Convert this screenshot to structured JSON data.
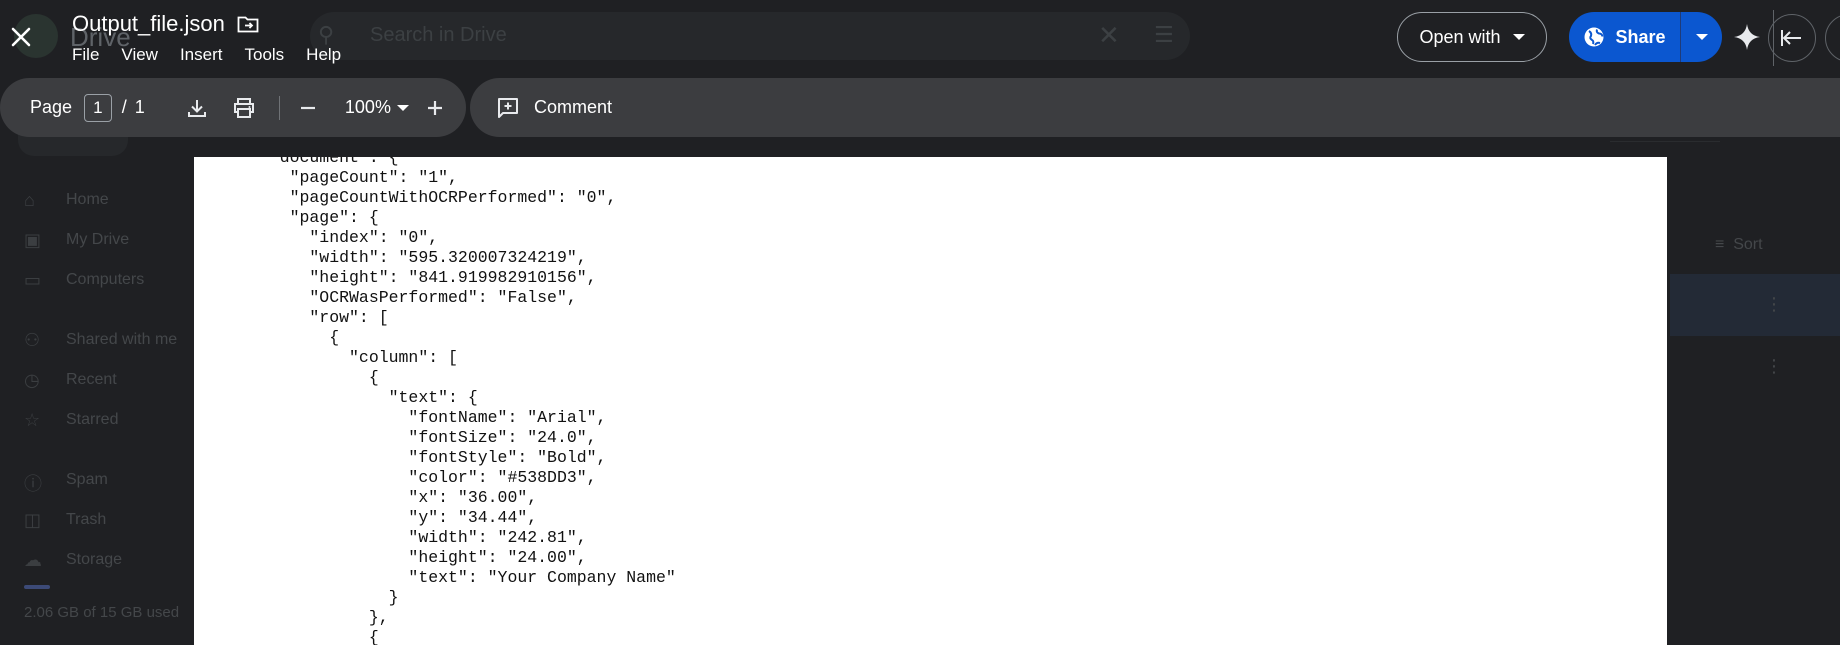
{
  "background": {
    "app_title": "Drive",
    "search_placeholder": "Search in Drive",
    "nav_items": [
      {
        "label": "Home",
        "icon": "home-icon"
      },
      {
        "label": "My Drive",
        "icon": "drive-icon"
      },
      {
        "label": "Computers",
        "icon": "computer-icon"
      },
      {
        "label": "Shared with me",
        "icon": "people-icon"
      },
      {
        "label": "Recent",
        "icon": "clock-icon"
      },
      {
        "label": "Starred",
        "icon": "star-icon"
      },
      {
        "label": "Spam",
        "icon": "spam-icon"
      },
      {
        "label": "Trash",
        "icon": "trash-icon"
      },
      {
        "label": "Storage",
        "icon": "cloud-icon"
      }
    ],
    "storage_text": "2.06 GB of 15 GB used",
    "sort_label": "Sort"
  },
  "viewer": {
    "file_name": "Output_file.json",
    "menu": [
      "File",
      "View",
      "Insert",
      "Tools",
      "Help"
    ],
    "open_with_label": "Open with",
    "share_label": "Share",
    "accent_color": "#0b57d0"
  },
  "toolbar": {
    "page_label": "Page",
    "current_page": "1",
    "page_separator": "/",
    "total_pages": "1",
    "zoom": "100%",
    "comment_label": "Comment"
  },
  "document": {
    "lines": [
      "  \"document\": {",
      "    \"pageCount\": \"1\",",
      "    \"pageCountWithOCRPerformed\": \"0\",",
      "    \"page\": {",
      "      \"index\": \"0\",",
      "      \"width\": \"595.320007324219\",",
      "      \"height\": \"841.919982910156\",",
      "      \"OCRWasPerformed\": \"False\",",
      "      \"row\": [",
      "        {",
      "          \"column\": [",
      "            {",
      "              \"text\": {",
      "                \"fontName\": \"Arial\",",
      "                \"fontSize\": \"24.0\",",
      "                \"fontStyle\": \"Bold\",",
      "                \"color\": \"#538DD3\",",
      "                \"x\": \"36.00\",",
      "                \"y\": \"34.44\",",
      "                \"width\": \"242.81\",",
      "                \"height\": \"24.00\",",
      "                \"text\": \"Your Company Name\"",
      "              }",
      "            },",
      "            {"
    ]
  }
}
